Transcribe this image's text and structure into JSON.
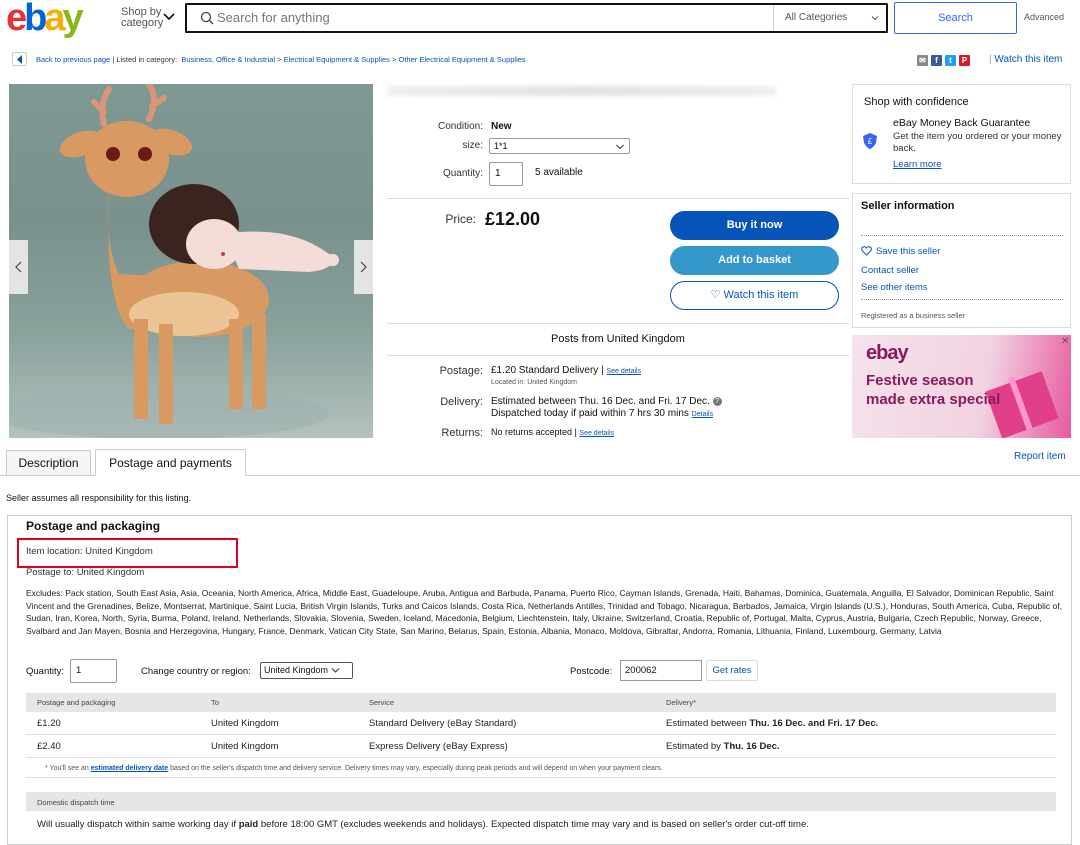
{
  "header": {
    "logo_letters": [
      "e",
      "b",
      "a",
      "y"
    ],
    "shop_by": "Shop by",
    "shop_by_2": "category",
    "search_placeholder": "Search for anything",
    "category_select": "All Categories",
    "search_button": "Search",
    "advanced": "Advanced"
  },
  "breadcrumb": {
    "back": "Back to previous page",
    "listed_in": "| Listed in category:",
    "items": [
      "Business, Office & Industrial",
      "Electrical Equipment & Supplies",
      "Other Electrical Equipment & Supplies"
    ],
    "separator": ">",
    "watch": "Watch this item"
  },
  "share_icons": [
    {
      "name": "email-icon",
      "glyph": "✉",
      "color": "#888888"
    },
    {
      "name": "facebook-icon",
      "glyph": "f",
      "color": "#3b5998"
    },
    {
      "name": "twitter-icon",
      "glyph": "t",
      "color": "#1da1f2"
    },
    {
      "name": "pinterest-icon",
      "glyph": "P",
      "color": "#cb2027"
    }
  ],
  "item": {
    "condition_label": "Condition:",
    "condition_value": "New",
    "size_label": "size:",
    "size_value": "1*1",
    "quantity_label": "Quantity:",
    "quantity_value": "1",
    "available": "5 available",
    "price_label": "Price:",
    "price_value": "£12.00",
    "buy_now": "Buy it now",
    "add_basket": "Add to basket",
    "watch": "♡ Watch this item",
    "posts_from": "Posts from United Kingdom",
    "postage_label": "Postage:",
    "postage_value": "£1.20  Standard Delivery |",
    "see_details": "See details",
    "located_in": "Located in: United Kingdom",
    "delivery_label": "Delivery:",
    "delivery_line1": "Estimated between Thu. 16 Dec. and Fri. 17 Dec.",
    "delivery_line2": "Dispatched today if paid within 7 hrs 30 mins",
    "details": "Details",
    "returns_label": "Returns:",
    "returns_value": "No returns accepted |",
    "returns_see": "See details"
  },
  "confidence": {
    "title": "Shop with confidence",
    "mbg_title": "eBay Money Back Guarantee",
    "mbg_desc": "Get the item you ordered or your money back.",
    "learn_more": "Learn more"
  },
  "seller": {
    "title": "Seller information",
    "save": "Save this seller",
    "contact": "Contact seller",
    "other": "See other items",
    "business": "Registered as a business seller"
  },
  "ad": {
    "logo": "ebay",
    "text": "Festive season made extra special",
    "close": "✕"
  },
  "tabs": {
    "description": "Description",
    "postage": "Postage and payments",
    "report": "Report item"
  },
  "disclaimer": "Seller assumes all responsibility for this listing.",
  "postage": {
    "title": "Postage and packaging",
    "item_location": "Item location: United Kingdom",
    "postage_to": "Postage to: United Kingdom",
    "excludes": "Excludes: Pack station, South East Asia, Asia, Oceania, North America, Africa, Middle East, Guadeloupe, Aruba, Antigua and Barbuda, Panama, Puerto Rico, Cayman Islands, Grenada, Haiti, Bahamas, Dominica, Guatemala, Anguilla, El Salvador, Dominican Republic, Saint Vincent and the Grenadines, Belize, Montserrat, Martinique, Saint Lucia, British Virgin Islands, Turks and Caicos Islands, Costa Rica, Netherlands Antilles, Trinidad and Tobago, Nicaragua, Barbados, Jamaica, Virgin Islands (U.S.), Honduras, South America, Cuba, Republic of, Sudan, Iran, Korea, North, Syria, Burma, Poland, Ireland, Netherlands, Slovakia, Slovenia, Sweden, Iceland, Macedonia, Belgium, Liechtenstein, Italy, Ukraine, Switzerland, Croatia, Republic of, Portugal, Malta, Cyprus, Austria, Bulgaria, Czech Republic, Norway, Greece, Svalbard and Jan Mayen, Bosnia and Herzegovina, Hungary, France, Denmark, Vatican City State, San Marino, Belarus, Spain, Estonia, Albania, Monaco, Moldova, Gibraltar, Andorra, Romania, Lithuania, Finland, Luxembourg, Germany, Latvia",
    "quantity_label": "Quantity:",
    "quantity_value": "1",
    "country_label": "Change country or region:",
    "country_value": "United Kingdom",
    "postcode_label": "Postcode:",
    "postcode_value": "200062",
    "get_rates": "Get rates",
    "columns": [
      "Postage and packaging",
      "To",
      "Service",
      "Delivery*"
    ],
    "rows": [
      {
        "price": "£1.20",
        "to": "United Kingdom",
        "service": "Standard Delivery (eBay Standard)",
        "delivery_pre": "Estimated between ",
        "delivery_bold": "Thu. 16 Dec. and Fri. 17 Dec."
      },
      {
        "price": "£2.40",
        "to": "United Kingdom",
        "service": "Express Delivery (eBay Express)",
        "delivery_pre": "Estimated by ",
        "delivery_bold": "Thu. 16 Dec."
      }
    ],
    "footnote_pre": "* You'll see an ",
    "footnote_link": "estimated delivery date",
    "footnote_post": " based on the seller's dispatch time and delivery service. Delivery times may vary, especially during peak periods and will depend on when your payment clears.",
    "dispatch_title": "Domestic dispatch time",
    "dispatch_pre": "Will usually dispatch within same working day if ",
    "dispatch_bold": "paid",
    "dispatch_post": " before 18:00 GMT (excludes weekends and holidays). Expected dispatch time may vary and is based on seller's order cut-off time."
  }
}
